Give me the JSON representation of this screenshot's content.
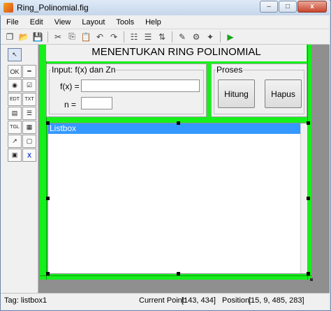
{
  "window": {
    "title": "Ring_Polinomial.fig",
    "minimize": "–",
    "maximize": "□",
    "close": "x"
  },
  "menu": [
    {
      "label": "File"
    },
    {
      "label": "Edit"
    },
    {
      "label": "View"
    },
    {
      "label": "Layout"
    },
    {
      "label": "Tools"
    },
    {
      "label": "Help"
    }
  ],
  "toolbar": {
    "icons": [
      "new-file-icon",
      "open-icon",
      "save-icon",
      "cut-icon",
      "copy-icon",
      "paste-icon",
      "undo-icon",
      "redo-icon",
      "align-icon",
      "menu-editor-icon",
      "tab-order-icon",
      "mfile-editor-icon",
      "property-inspector-icon",
      "object-browser-icon",
      "run-icon"
    ],
    "glyphs": [
      "❐",
      "📂",
      "💾",
      "✂",
      "⎘",
      "📋",
      "↶",
      "↷",
      "☷",
      "☰",
      "⇅",
      "✎",
      "⚙",
      "✦",
      "▶"
    ]
  },
  "palette": {
    "items": [
      {
        "name": "select-tool-icon",
        "glyph": "↖"
      },
      {
        "name": "pushbutton-tool-icon",
        "glyph": "OK"
      },
      {
        "name": "slider-tool-icon",
        "glyph": "━"
      },
      {
        "name": "radiobutton-tool-icon",
        "glyph": "◉"
      },
      {
        "name": "checkbox-tool-icon",
        "glyph": "☑"
      },
      {
        "name": "edit-text-tool-icon",
        "glyph": "EDT"
      },
      {
        "name": "static-text-tool-icon",
        "glyph": "TXT"
      },
      {
        "name": "popup-menu-tool-icon",
        "glyph": "▤"
      },
      {
        "name": "listbox-tool-icon",
        "glyph": "☰"
      },
      {
        "name": "toggle-button-tool-icon",
        "glyph": "TGL"
      },
      {
        "name": "table-tool-icon",
        "glyph": "▦"
      },
      {
        "name": "axes-tool-icon",
        "glyph": "↗"
      },
      {
        "name": "panel-tool-icon",
        "glyph": "▢"
      },
      {
        "name": "button-group-tool-icon",
        "glyph": "▣"
      },
      {
        "name": "activex-tool-icon",
        "glyph": "X"
      }
    ]
  },
  "figure": {
    "title": "MENENTUKAN RING POLINOMIAL",
    "input_panel": {
      "legend": "Input: f(x) dan Zn",
      "fx_label": "f(x) =",
      "n_label": "n =",
      "fx_value": "",
      "n_value": ""
    },
    "process_panel": {
      "legend": "Proses",
      "hitung_label": "Hitung",
      "hapus_label": "Hapus"
    },
    "listbox": {
      "selected_item": "Listbox"
    }
  },
  "status": {
    "tag": "Tag: listbox1",
    "current_point_label": "Current Point:",
    "current_point": "[143, 434]",
    "position_label": "Position:",
    "position": "[15, 9, 485, 283]"
  },
  "colors": {
    "figure_bg": "#15f01b",
    "selection": "#3399ff"
  }
}
